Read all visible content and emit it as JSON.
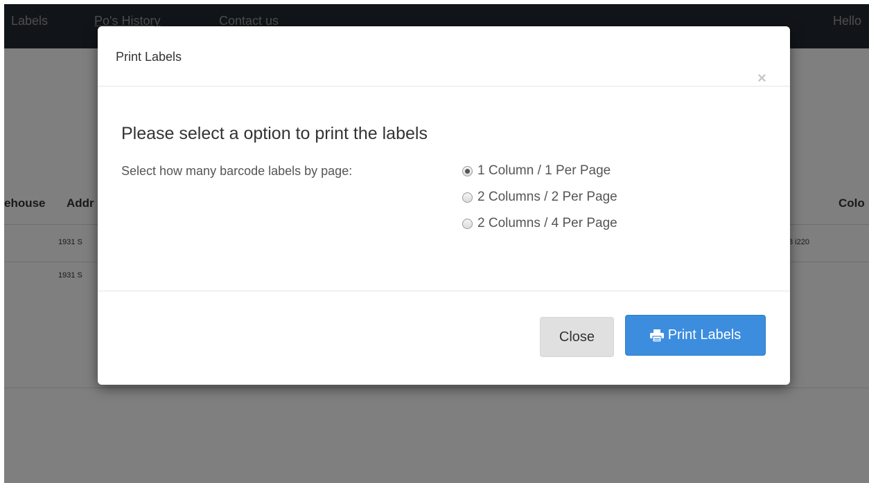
{
  "nav": {
    "labels": "Labels",
    "history": "Po's History",
    "contact": "Contact us",
    "hello": "Hello"
  },
  "table": {
    "headers": {
      "warehouse": "ehouse",
      "address": "Addr",
      "color": "Colo"
    },
    "rows": [
      {
        "address": "1931 S",
        "right": "8 i220"
      },
      {
        "address": "1931 S",
        "right": ""
      }
    ]
  },
  "modal": {
    "title": "Print Labels",
    "close_symbol": "×",
    "heading": "Please select a option to print the labels",
    "select_label": "Select how many barcode labels by page:",
    "options": [
      {
        "label": "1 Column / 1 Per Page",
        "checked": true
      },
      {
        "label": "2 Columns / 2 Per Page",
        "checked": false
      },
      {
        "label": "2 Columns / 4 Per Page",
        "checked": false
      }
    ],
    "close_button": "Close",
    "print_button": "Print Labels",
    "print_icon": "printer-icon"
  },
  "colors": {
    "navbar": "#222a33",
    "primary": "#3c8dde",
    "backdrop": "rgba(0,0,0,0.5)"
  }
}
